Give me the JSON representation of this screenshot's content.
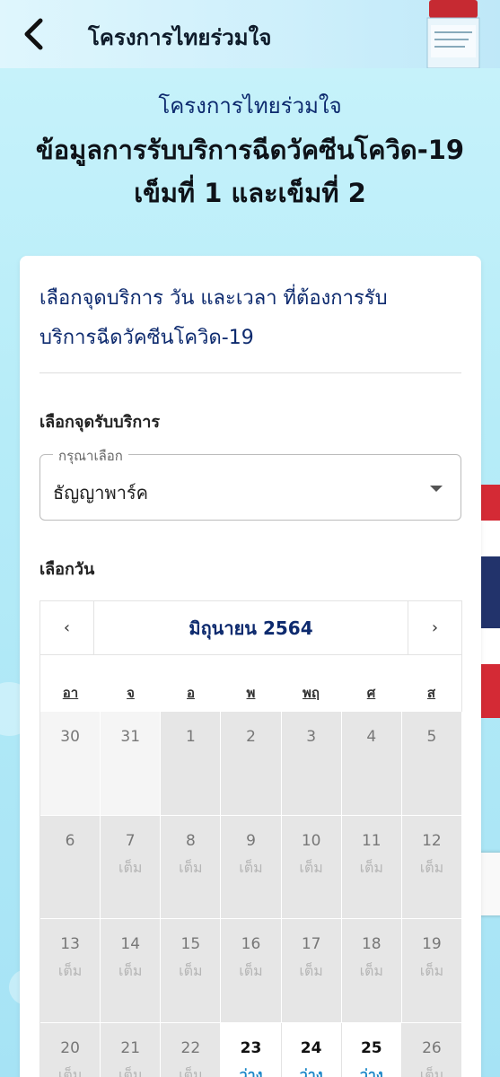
{
  "header": {
    "title": "โครงการไทยร่วมใจ",
    "back_icon": "chevron-left-icon"
  },
  "hero": {
    "subtitle": "โครงการไทยร่วมใจ",
    "title_line1": "ข้อมูลการรับบริการฉีดวัคซีนโควิด-19",
    "title_line2": "เข็มที่ 1 และเข็มที่ 2"
  },
  "card": {
    "title_line1": "เลือกจุดบริการ วัน และเวลา ที่ต้องการรับ",
    "title_line2": "บริการฉีดวัคซีนโควิด-19",
    "location_label": "เลือกจุดรับบริการ",
    "select": {
      "legend": "กรุณาเลือก",
      "value": "ธัญญาพาร์ค"
    },
    "date_label": "เลือกวัน"
  },
  "calendar": {
    "prev": "‹",
    "next": "›",
    "month": "มิถุนายน 2564",
    "weekdays": [
      "อา",
      "จ",
      "อ",
      "พ",
      "พฤ",
      "ศ",
      "ส"
    ],
    "days": [
      {
        "num": "30",
        "status": "",
        "kind": "prevmonth"
      },
      {
        "num": "31",
        "status": "",
        "kind": "prevmonth"
      },
      {
        "num": "1",
        "status": "",
        "kind": "closed"
      },
      {
        "num": "2",
        "status": "",
        "kind": "closed"
      },
      {
        "num": "3",
        "status": "",
        "kind": "closed"
      },
      {
        "num": "4",
        "status": "",
        "kind": "closed"
      },
      {
        "num": "5",
        "status": "",
        "kind": "closed"
      },
      {
        "num": "6",
        "status": "",
        "kind": "closed"
      },
      {
        "num": "7",
        "status": "เต็ม",
        "kind": "full"
      },
      {
        "num": "8",
        "status": "เต็ม",
        "kind": "full"
      },
      {
        "num": "9",
        "status": "เต็ม",
        "kind": "full"
      },
      {
        "num": "10",
        "status": "เต็ม",
        "kind": "full"
      },
      {
        "num": "11",
        "status": "เต็ม",
        "kind": "full"
      },
      {
        "num": "12",
        "status": "เต็ม",
        "kind": "full"
      },
      {
        "num": "13",
        "status": "เต็ม",
        "kind": "full"
      },
      {
        "num": "14",
        "status": "เต็ม",
        "kind": "full"
      },
      {
        "num": "15",
        "status": "เต็ม",
        "kind": "full"
      },
      {
        "num": "16",
        "status": "เต็ม",
        "kind": "full"
      },
      {
        "num": "17",
        "status": "เต็ม",
        "kind": "full"
      },
      {
        "num": "18",
        "status": "เต็ม",
        "kind": "full"
      },
      {
        "num": "19",
        "status": "เต็ม",
        "kind": "full"
      },
      {
        "num": "20",
        "status": "เต็ม",
        "kind": "full"
      },
      {
        "num": "21",
        "status": "เต็ม",
        "kind": "full"
      },
      {
        "num": "22",
        "status": "เต็ม",
        "kind": "full"
      },
      {
        "num": "23",
        "status": "ว่าง",
        "kind": "open"
      },
      {
        "num": "24",
        "status": "ว่าง",
        "kind": "open"
      },
      {
        "num": "25",
        "status": "ว่าง",
        "kind": "open"
      },
      {
        "num": "26",
        "status": "เต็ม",
        "kind": "full"
      }
    ]
  },
  "colors": {
    "accent": "#0d2a6e",
    "available": "#1e88c8",
    "full_cell": "#e6e6e6"
  }
}
